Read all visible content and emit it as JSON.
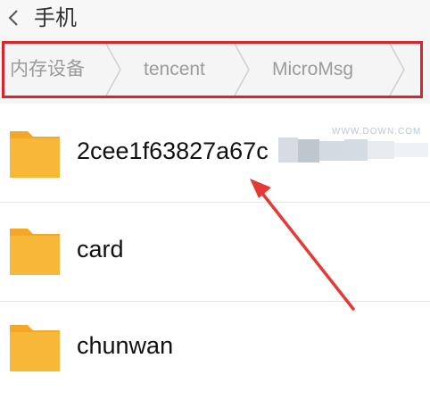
{
  "header": {
    "title": "手机",
    "back_icon": "chevron-left-icon"
  },
  "breadcrumb": {
    "items": [
      "内存设备",
      "tencent",
      "MicroMsg"
    ],
    "highlight_color": "#d9262d"
  },
  "files": [
    {
      "name": "2cee1f63827a67c",
      "icon": "folder-icon"
    },
    {
      "name": "card",
      "icon": "folder-icon"
    },
    {
      "name": "chunwan",
      "icon": "folder-icon"
    }
  ],
  "colors": {
    "folder": "#f7b83a",
    "folder_tab": "#f2a826",
    "annotation_arrow": "#e53935"
  },
  "watermark": {
    "text": "WWW.DOWN.COM"
  }
}
